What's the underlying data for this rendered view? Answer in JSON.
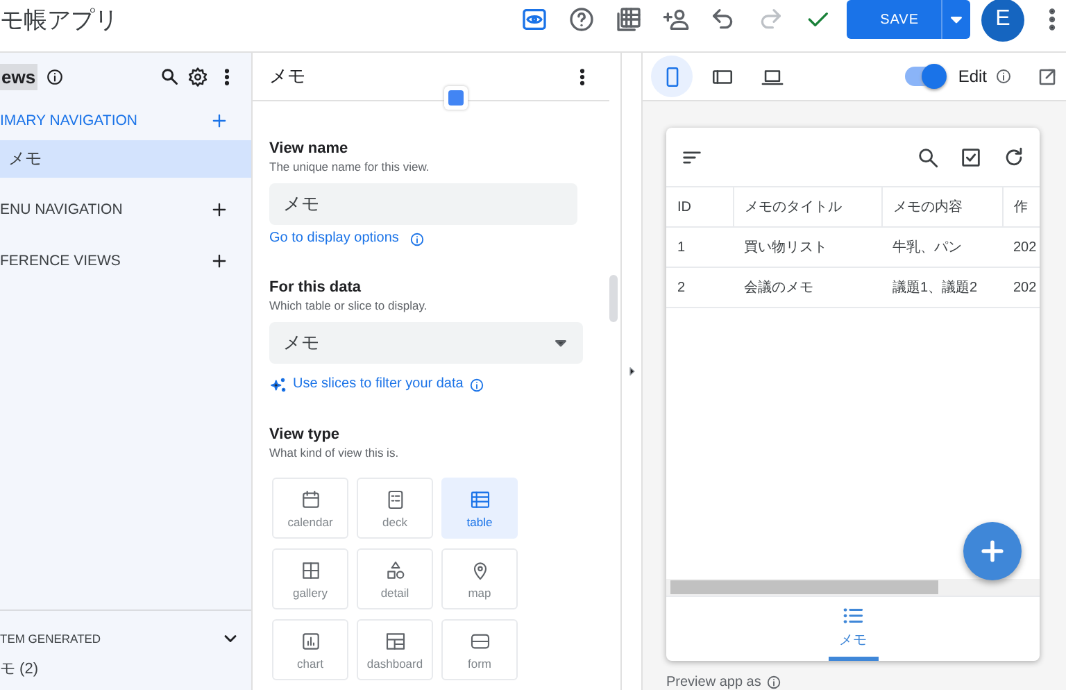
{
  "app_title": "モ帳アプリ",
  "toolbar": {
    "save_label": "SAVE",
    "avatar_initial": "E"
  },
  "sidebar": {
    "header": "ews",
    "sections": [
      {
        "title": "IMARY NAVIGATION",
        "active": true,
        "items": [
          {
            "label": "メモ",
            "selected": true
          }
        ]
      },
      {
        "title": "ENU NAVIGATION",
        "active": false
      },
      {
        "title": "FERENCE VIEWS",
        "active": false
      }
    ],
    "system_generated": {
      "title": "TEM GENERATED",
      "items": [
        "モ (2)"
      ]
    }
  },
  "editor": {
    "title": "メモ",
    "view_name": {
      "label": "View name",
      "hint": "The unique name for this view.",
      "value": "メモ",
      "link": "Go to display options"
    },
    "data_source": {
      "label": "For this data",
      "hint": "Which table or slice to display.",
      "value": "メモ",
      "link": "Use slices to filter your data"
    },
    "view_type": {
      "label": "View type",
      "hint": "What kind of view this is.",
      "options": [
        {
          "kind": "calendar",
          "label": "calendar",
          "selected": false
        },
        {
          "kind": "deck",
          "label": "deck",
          "selected": false
        },
        {
          "kind": "table",
          "label": "table",
          "selected": true
        },
        {
          "kind": "gallery",
          "label": "gallery",
          "selected": false
        },
        {
          "kind": "detail",
          "label": "detail",
          "selected": false
        },
        {
          "kind": "map",
          "label": "map",
          "selected": false
        },
        {
          "kind": "chart",
          "label": "chart",
          "selected": false
        },
        {
          "kind": "dashboard",
          "label": "dashboard",
          "selected": false
        },
        {
          "kind": "form",
          "label": "form",
          "selected": false
        }
      ]
    }
  },
  "preview": {
    "devices": [
      {
        "kind": "phone",
        "selected": true
      },
      {
        "kind": "tablet",
        "selected": false
      },
      {
        "kind": "desktop",
        "selected": false
      }
    ],
    "edit_mode": {
      "label": "Edit",
      "on": true
    },
    "table": {
      "columns": [
        "ID",
        "メモのタイトル",
        "メモの内容",
        "作"
      ],
      "rows": [
        [
          "1",
          "買い物リスト",
          "牛乳、パン",
          "202"
        ],
        [
          "2",
          "会議のメモ",
          "議題1、議題2",
          "202"
        ]
      ]
    },
    "bottom_nav": [
      {
        "label": "メモ",
        "selected": true
      }
    ],
    "footer": "Preview app as"
  }
}
